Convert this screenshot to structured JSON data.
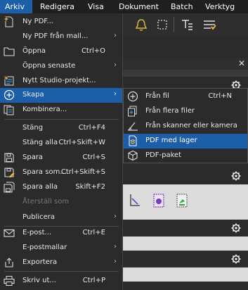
{
  "menubar": {
    "items": [
      {
        "label": "Arkiv"
      },
      {
        "label": "Redigera"
      },
      {
        "label": "Visa"
      },
      {
        "label": "Dokument"
      },
      {
        "label": "Batch"
      },
      {
        "label": "Verktyg"
      }
    ]
  },
  "file_menu": {
    "items": [
      {
        "label": "Ny PDF...",
        "shortcut": "",
        "icon": "new-pdf-icon"
      },
      {
        "label": "Ny PDF från mall...",
        "shortcut": "",
        "icon": ""
      },
      {
        "label": "Öppna",
        "shortcut": "Ctrl+O",
        "icon": "folder-icon"
      },
      {
        "label": "Öppna senaste",
        "shortcut": "",
        "icon": ""
      },
      {
        "label": "Nytt Studio-projekt...",
        "shortcut": "",
        "icon": "studio-project-icon"
      },
      {
        "label": "Skapa",
        "shortcut": "",
        "icon": "plus-circle-icon"
      },
      {
        "label": "Kombinera...",
        "shortcut": "",
        "icon": "combine-icon"
      },
      {
        "label": "Stäng",
        "shortcut": "Ctrl+F4",
        "icon": ""
      },
      {
        "label": "Stäng alla",
        "shortcut": "Ctrl+Skift+W",
        "icon": ""
      },
      {
        "label": "Spara",
        "shortcut": "Ctrl+S",
        "icon": "save-icon"
      },
      {
        "label": "Spara som...",
        "shortcut": "Ctrl+Skift+S",
        "icon": "save-as-icon"
      },
      {
        "label": "Spara alla",
        "shortcut": "Skift+F2",
        "icon": "save-all-icon"
      },
      {
        "label": "Återställ som",
        "shortcut": "",
        "icon": ""
      },
      {
        "label": "Publicera",
        "shortcut": "",
        "icon": ""
      },
      {
        "label": "E-post...",
        "shortcut": "Ctrl+E",
        "icon": "envelope-icon"
      },
      {
        "label": "E-postmallar",
        "shortcut": "",
        "icon": ""
      },
      {
        "label": "Exportera",
        "shortcut": "",
        "icon": "export-icon"
      },
      {
        "label": "Skriv ut...",
        "shortcut": "Ctrl+P",
        "icon": "printer-icon"
      }
    ],
    "arrow": "›"
  },
  "create_submenu": {
    "items": [
      {
        "label": "Från fil",
        "shortcut": "Ctrl+N",
        "icon": "plus-circle-icon"
      },
      {
        "label": "Från flera filer",
        "shortcut": "",
        "icon": "multiple-files-icon"
      },
      {
        "label": "Från skanner eller kamera",
        "shortcut": "",
        "icon": "scanner-icon"
      },
      {
        "label": "PDF med lager",
        "shortcut": "",
        "icon": "layers-icon"
      },
      {
        "label": "PDF-paket",
        "shortcut": "",
        "icon": "package-icon"
      }
    ]
  },
  "close_glyph": "✕",
  "colors": {
    "highlight": "#1c5ea8",
    "menu_bg": "#2b2b2b",
    "menubar_bg": "#1f1f1f"
  }
}
